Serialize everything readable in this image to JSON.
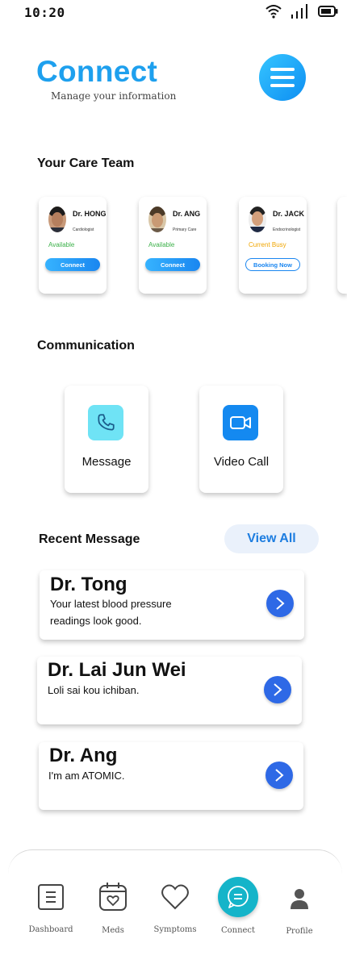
{
  "status_bar": {
    "time": "10:20"
  },
  "header": {
    "title": "Connect",
    "subtitle": "Manage your information"
  },
  "care_team": {
    "title": "Your Care Team",
    "doctors": [
      {
        "name": "Dr. HONG",
        "specialty": "Cardiologist",
        "status": "Available",
        "status_color": "#3cb14a",
        "action": "Connect"
      },
      {
        "name": "Dr. ANG",
        "specialty": "Primary Care",
        "status": "Available",
        "status_color": "#3cb14a",
        "action": "Connect"
      },
      {
        "name": "Dr. JACK",
        "specialty": "Endocrinologist",
        "status": "Current Busy",
        "status_color": "#f0a500",
        "action": "Booking Now"
      }
    ]
  },
  "communication": {
    "title": "Communication",
    "options": [
      {
        "label": "Message",
        "icon": "phone-icon",
        "color": "#6fe3f5"
      },
      {
        "label": "Video Call",
        "icon": "video-camera-icon",
        "color": "#1489f0"
      }
    ]
  },
  "recent_messages": {
    "title": "Recent Message",
    "view_all": "View All",
    "items": [
      {
        "sender": "Dr. Tong",
        "text": "Your latest blood pressure readings look good."
      },
      {
        "sender": "Dr. Lai Jun Wei",
        "text": "Loli sai kou ichiban."
      },
      {
        "sender": "Dr. Ang",
        "text": "I'm am ATOMIC."
      }
    ]
  },
  "bottom_nav": {
    "items": [
      {
        "label": "Dashboard",
        "icon": "dashboard-icon"
      },
      {
        "label": "Meds",
        "icon": "calendar-heart-icon"
      },
      {
        "label": "Symptoms",
        "icon": "heart-icon"
      },
      {
        "label": "Connect",
        "icon": "chat-icon",
        "active": true
      },
      {
        "label": "Profile",
        "icon": "person-icon"
      }
    ]
  }
}
